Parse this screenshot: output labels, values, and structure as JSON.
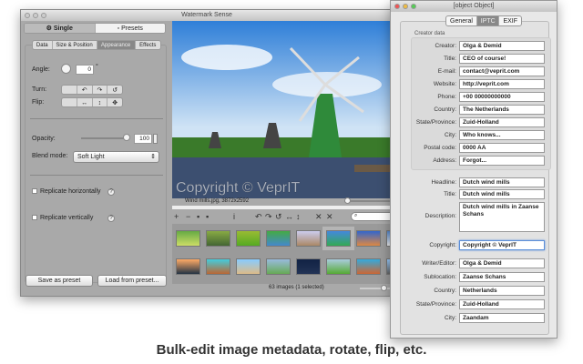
{
  "main_window": {
    "title": "Watermark Sense",
    "mode_tabs": [
      {
        "label": "Single",
        "icon": "gear-icon",
        "selected": true
      },
      {
        "label": "Presets",
        "icon": "preset-icon",
        "selected": false
      }
    ],
    "sub_tabs": [
      {
        "label": "Data"
      },
      {
        "label": "Size & Position"
      },
      {
        "label": "Appearance",
        "selected": true
      },
      {
        "label": "Effects"
      }
    ],
    "angle_label": "Angle:",
    "angle_value": "0",
    "angle_unit": "°",
    "turn_label": "Turn:",
    "flip_label": "Flip:",
    "opacity_label": "Opacity:",
    "opacity_value": "100",
    "blend_label": "Blend mode:",
    "blend_value": "Soft Light",
    "replicate_h": "Replicate horizontally",
    "replicate_v": "Replicate vertically",
    "help": "?",
    "save_preset": "Save as preset",
    "load_preset": "Load from preset...",
    "watermark_text": "Copyright © VeprIT",
    "image_info": "Wind mills.jpg,  3872x2592",
    "status": "63 images (1 selected)"
  },
  "metadata_window": {
    "title": {
      "label": "Title:",
      "value": "Dutch wind mills"
    },
    "tabs": [
      {
        "label": "General"
      },
      {
        "label": "IPTC",
        "selected": true
      },
      {
        "label": "EXIF"
      }
    ],
    "creator_group": "Creator data",
    "creator_fields": [
      {
        "label": "Creator:",
        "value": "Olga & Demid"
      },
      {
        "label": "Title:",
        "value": "CEO of course!"
      },
      {
        "label": "E-mail:",
        "value": "contact@veprit.com"
      },
      {
        "label": "Website:",
        "value": "http://veprit.com"
      },
      {
        "label": "Phone:",
        "value": "+00 00000000000"
      },
      {
        "label": "Country:",
        "value": "The Netherlands"
      },
      {
        "label": "State/Province:",
        "value": "Zuid-Holland"
      },
      {
        "label": "City:",
        "value": "Who knows..."
      },
      {
        "label": "Postal code:",
        "value": "0000 AA"
      },
      {
        "label": "Address:",
        "value": "Forgot..."
      }
    ],
    "headline": {
      "label": "Headline:",
      "value": "Dutch wind mills"
    },
    "description": {
      "label": "Description:",
      "value": "Dutch wind mills in Zaanse Schans"
    },
    "copyright": {
      "label": "Copyright:",
      "value": "Copyright © VeprIT"
    },
    "other_fields": [
      {
        "label": "Writer/Editor:",
        "value": "Olga & Demid"
      },
      {
        "label": "Sublocation:",
        "value": "Zaanse Schans"
      },
      {
        "label": "Country:",
        "value": "Netherlands"
      },
      {
        "label": "State/Province:",
        "value": "Zuid-Holland"
      },
      {
        "label": "City:",
        "value": "Zaandam"
      }
    ]
  },
  "caption": "Bulk-edit image metadata, rotate, flip, etc."
}
